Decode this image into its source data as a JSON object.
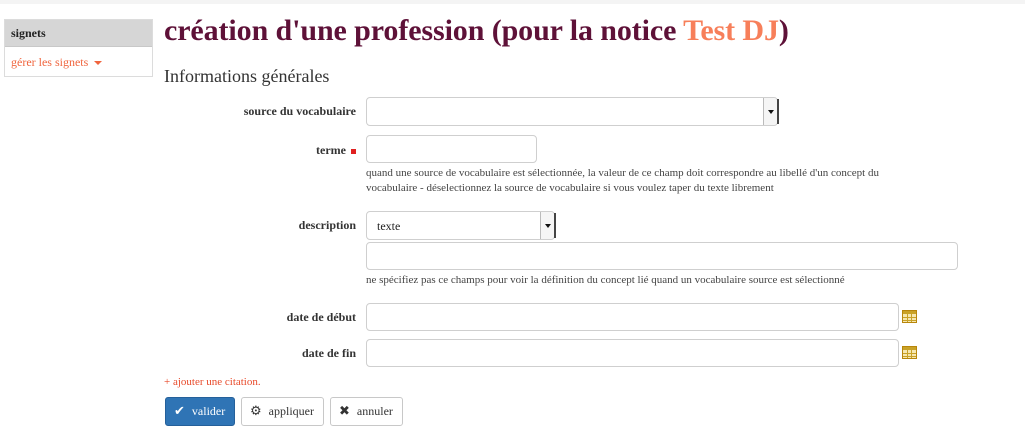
{
  "sidebar": {
    "header": "signets",
    "manage_label": "gérer les signets"
  },
  "page": {
    "title_prefix": "création d'une profession (pour la notice ",
    "title_record": "Test DJ",
    "title_suffix": ")",
    "section_title": "Informations générales"
  },
  "form": {
    "vocab_source": {
      "label": "source du vocabulaire",
      "value": ""
    },
    "term": {
      "label": "terme",
      "value": "",
      "help": [
        "quand une source de vocabulaire est sélectionnée, la valeur de ce champ doit correspondre au libellé d'un concept du",
        "vocabulaire - déselectionnez la source de vocabulaire si vous voulez taper du texte librement"
      ]
    },
    "description": {
      "label": "description",
      "format_value": "texte",
      "value": "",
      "help": "ne spécifiez pas ce champs pour voir la définition du concept lié quand un vocabulaire source est sélectionné"
    },
    "start_date": {
      "label": "date de début",
      "value": ""
    },
    "end_date": {
      "label": "date de fin",
      "value": ""
    },
    "add_citation": "+ ajouter une citation."
  },
  "actions": {
    "validate": "valider",
    "apply": "appliquer",
    "cancel": "annuler"
  },
  "icons": {
    "validate": "check-icon",
    "apply": "gear-icon",
    "cancel": "close-icon",
    "date": "calendar-icon"
  },
  "colors": {
    "title": "#5e1138",
    "title_highlight": "#f77f5a",
    "link": "#f0653e",
    "primary_button": "#2f74b5"
  }
}
